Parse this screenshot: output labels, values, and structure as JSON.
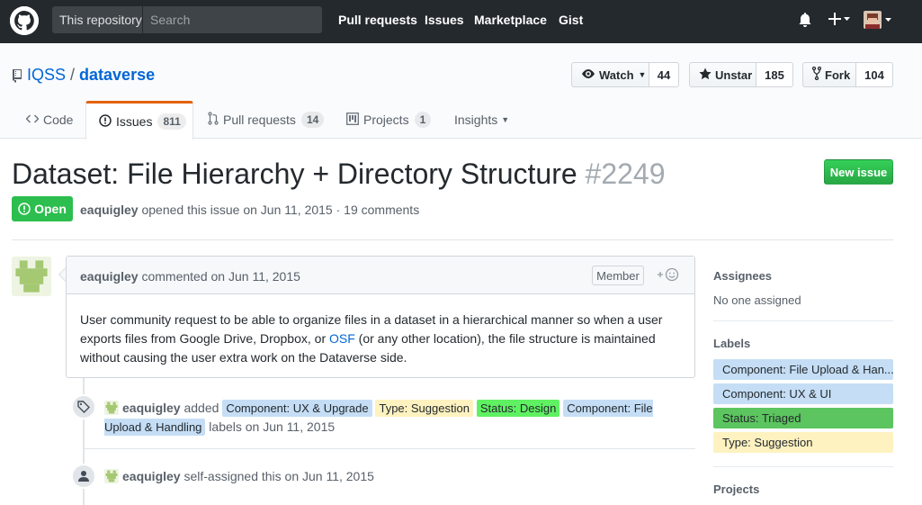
{
  "header": {
    "search_scope": "This repository",
    "search_placeholder": "Search",
    "nav": [
      "Pull requests",
      "Issues",
      "Marketplace",
      "Gist"
    ],
    "icons": [
      "github-logo-icon",
      "bell-icon",
      "plus-icon",
      "avatar"
    ]
  },
  "repo": {
    "owner": "IQSS",
    "name": "dataverse",
    "watch_label": "Watch",
    "watch_count": "44",
    "star_label": "Unstar",
    "star_count": "185",
    "fork_label": "Fork",
    "fork_count": "104"
  },
  "tabs": [
    {
      "label": "Code"
    },
    {
      "label": "Issues",
      "count": "811",
      "selected": true
    },
    {
      "label": "Pull requests",
      "count": "14"
    },
    {
      "label": "Projects",
      "count": "1"
    },
    {
      "label": "Insights"
    }
  ],
  "issue": {
    "title": "Dataset: File Hierarchy + Directory Structure",
    "number": "#2249",
    "new_issue_label": "New issue",
    "state": "Open",
    "author": "eaquigley",
    "meta_text": "opened this issue on Jun 11, 2015 · 19 comments"
  },
  "comment": {
    "author": "eaquigley",
    "date_text": "commented on Jun 11, 2015",
    "role": "Member",
    "body_1": "User community request to be able to organize files in a dataset in a hierarchical manner so when a user exports files from Google Drive, Dropbox, or ",
    "link": "OSF",
    "body_2": " (or any other location), the file structure is maintained without causing the user extra work on the Dataverse side."
  },
  "events": [
    {
      "actor": "eaquigley",
      "verb": "added",
      "labels": [
        {
          "name": "Component: UX & Upgrade",
          "color": "#c5def5"
        },
        {
          "name": "Type: Suggestion",
          "color": "#fef2c0"
        },
        {
          "name": "Status: Design",
          "color": "#5ff162"
        },
        {
          "name": "Component: File Upload & Handling",
          "color": "#c5def5"
        }
      ],
      "suffix": "labels on Jun 11, 2015"
    },
    {
      "actor": "eaquigley",
      "text": "self-assigned this on Jun 11, 2015"
    }
  ],
  "sidebar": {
    "assignees_heading": "Assignees",
    "assignees_value": "No one assigned",
    "labels_heading": "Labels",
    "labels": [
      {
        "name": "Component: File Upload & Han...",
        "color": "#c5def5"
      },
      {
        "name": "Component: UX & UI",
        "color": "#c5def5"
      },
      {
        "name": "Status: Triaged",
        "color": "#5cc55f"
      },
      {
        "name": "Type: Suggestion",
        "color": "#fef2c0"
      }
    ],
    "projects_heading": "Projects"
  }
}
